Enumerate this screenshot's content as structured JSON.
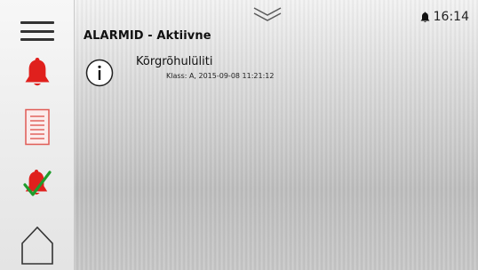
{
  "sidebar": {
    "items": [
      {
        "id": "menu",
        "icon": "hamburger-menu-icon"
      },
      {
        "id": "alarms",
        "icon": "alarm-bell-icon",
        "color": "#e0201d"
      },
      {
        "id": "log",
        "icon": "document-list-icon",
        "color": "#e05a55"
      },
      {
        "id": "acknowledged",
        "icon": "bell-check-icon",
        "color": "#e0201d",
        "check_color": "#1f9d2c"
      },
      {
        "id": "home",
        "icon": "home-icon"
      }
    ]
  },
  "status": {
    "bell_icon": "bell-icon",
    "time": "16:14"
  },
  "header": {
    "chevron_icon": "double-chevron-down-icon",
    "title": "ALARMID - Aktiivne"
  },
  "alarms": [
    {
      "icon": "info-icon",
      "name": "Kõrgrõhulüliti",
      "detail": "Klass: A, 2015-09-08 11:21:12"
    }
  ]
}
